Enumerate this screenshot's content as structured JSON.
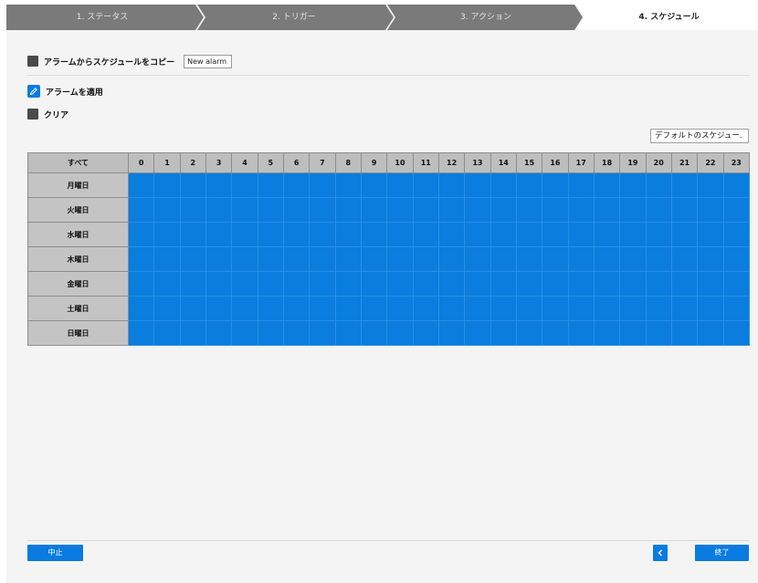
{
  "steps": [
    {
      "label": "1. ステータス"
    },
    {
      "label": "2. トリガー"
    },
    {
      "label": "3. アクション"
    },
    {
      "label": "4. スケジュール"
    }
  ],
  "copy": {
    "label": "アラームからスケジュールをコピー",
    "value": "New alarm"
  },
  "tools": {
    "apply_label": "アラームを適用",
    "clear_label": "クリア"
  },
  "default_schedule_label": "デフォルトのスケジュー.",
  "grid": {
    "corner": "すべて",
    "hours": [
      "0",
      "1",
      "2",
      "3",
      "4",
      "5",
      "6",
      "7",
      "8",
      "9",
      "10",
      "11",
      "12",
      "13",
      "14",
      "15",
      "16",
      "17",
      "18",
      "19",
      "20",
      "21",
      "22",
      "23"
    ],
    "days": [
      "月曜日",
      "火曜日",
      "水曜日",
      "木曜日",
      "金曜日",
      "土曜日",
      "日曜日"
    ]
  },
  "footer": {
    "cancel_label": "中止",
    "back_icon": "chevron-left-icon",
    "finish_label": "終了"
  },
  "colors": {
    "accent": "#0a7be0",
    "schedule_fill": "#0a7ddf",
    "step_inactive": "#7a7a7a",
    "step_active": "#ffffff"
  }
}
